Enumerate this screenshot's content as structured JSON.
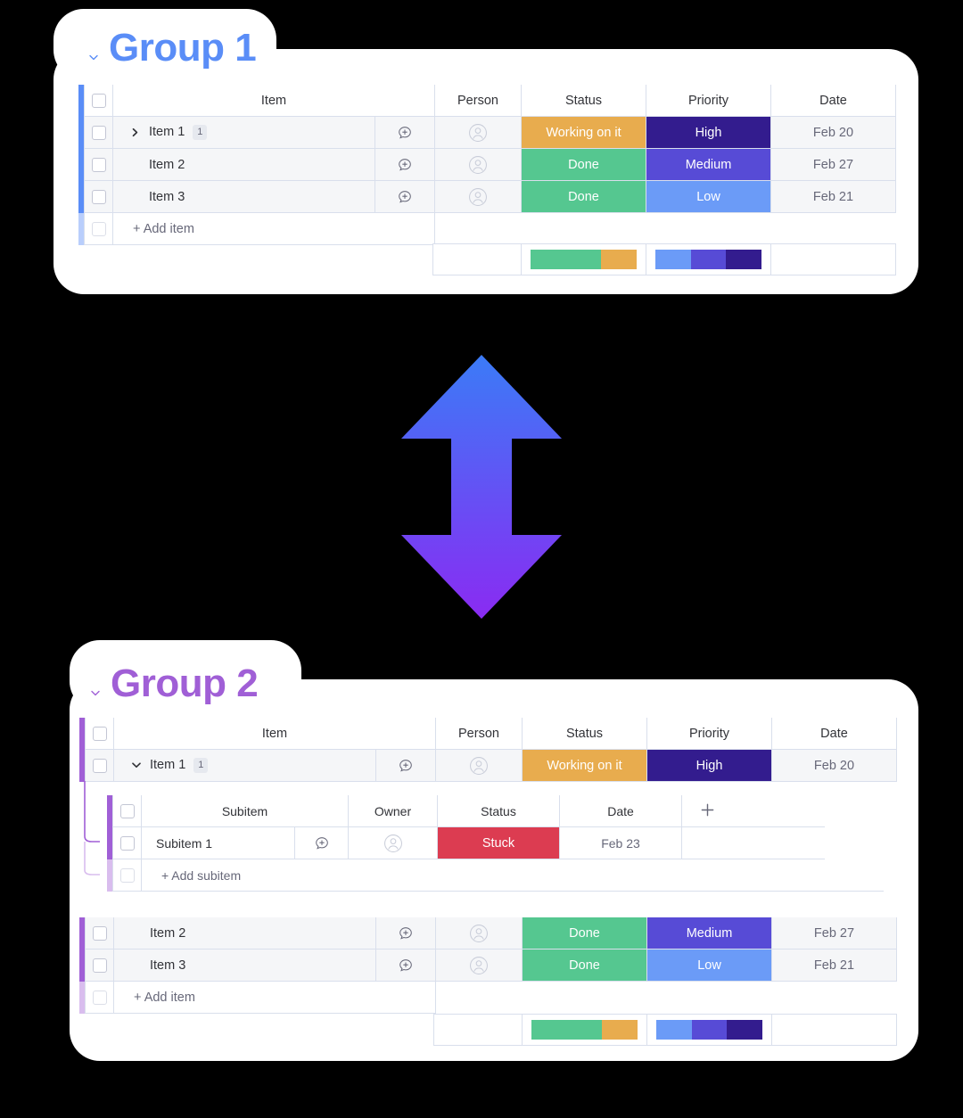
{
  "groups": [
    {
      "name": "Group 1",
      "accent": "#5A8DF7",
      "accent_light": "#b9cefc",
      "collapse_icon": "chevron-down-icon",
      "columns": [
        "Item",
        "Person",
        "Status",
        "Priority",
        "Date"
      ],
      "rows": [
        {
          "name": "Item 1",
          "count": "1",
          "expand_icon": "chevron-right-icon",
          "expanded": false,
          "chat_icon": "comment-add-icon",
          "person_icon": "avatar-icon",
          "status": "Working on it",
          "status_color": "#E8AC4E",
          "priority": "High",
          "priority_color": "#331C8E",
          "date": "Feb 20"
        },
        {
          "name": "Item 2",
          "count": "",
          "expand_icon": "",
          "expanded": false,
          "chat_icon": "comment-add-icon",
          "person_icon": "avatar-icon",
          "status": "Done",
          "status_color": "#55C790",
          "priority": "Medium",
          "priority_color": "#574BD6",
          "date": "Feb 27"
        },
        {
          "name": "Item 3",
          "count": "",
          "expand_icon": "",
          "expanded": false,
          "chat_icon": "comment-add-icon",
          "person_icon": "avatar-icon",
          "status": "Done",
          "status_color": "#55C790",
          "priority": "Low",
          "priority_color": "#6B9BF7",
          "date": "Feb 21"
        }
      ],
      "add_item_label": "+ Add item",
      "summary": {
        "status_segments": [
          {
            "label": "Done",
            "color": "#55C790",
            "pct": 66.7
          },
          {
            "label": "Working on it",
            "color": "#E8AC4E",
            "pct": 33.3
          }
        ],
        "priority_segments": [
          {
            "label": "Low",
            "color": "#6B9BF7",
            "pct": 33.3
          },
          {
            "label": "Medium",
            "color": "#574BD6",
            "pct": 33.3
          },
          {
            "label": "High",
            "color": "#331C8E",
            "pct": 33.4
          }
        ]
      }
    },
    {
      "name": "Group 2",
      "accent": "#A05FD6",
      "accent_light": "#d9bdee",
      "collapse_icon": "chevron-down-icon",
      "columns": [
        "Item",
        "Person",
        "Status",
        "Priority",
        "Date"
      ],
      "rows": [
        {
          "name": "Item 1",
          "count": "1",
          "expand_icon": "chevron-down-icon",
          "expanded": true,
          "chat_icon": "comment-add-icon",
          "person_icon": "avatar-icon",
          "status": "Working on it",
          "status_color": "#E8AC4E",
          "priority": "High",
          "priority_color": "#331C8E",
          "date": "Feb 20"
        },
        {
          "name": "Item 2",
          "count": "",
          "expand_icon": "",
          "expanded": false,
          "chat_icon": "comment-add-icon",
          "person_icon": "avatar-icon",
          "status": "Done",
          "status_color": "#55C790",
          "priority": "Medium",
          "priority_color": "#574BD6",
          "date": "Feb 27"
        },
        {
          "name": "Item 3",
          "count": "",
          "expand_icon": "",
          "expanded": false,
          "chat_icon": "comment-add-icon",
          "person_icon": "avatar-icon",
          "status": "Done",
          "status_color": "#55C790",
          "priority": "Low",
          "priority_color": "#6B9BF7",
          "date": "Feb 21"
        }
      ],
      "add_item_label": "+ Add item",
      "subitems": {
        "columns": [
          "Subitem",
          "Owner",
          "Status",
          "Date"
        ],
        "add_column_icon": "plus-icon",
        "rows": [
          {
            "name": "Subitem 1",
            "chat_icon": "comment-add-icon",
            "owner_icon": "avatar-icon",
            "status": "Stuck",
            "status_color": "#DC3C51",
            "date": "Feb 23"
          }
        ],
        "add_subitem_label": "+ Add subitem"
      },
      "summary": {
        "status_segments": [
          {
            "label": "Done",
            "color": "#55C790",
            "pct": 66.7
          },
          {
            "label": "Working on it",
            "color": "#E8AC4E",
            "pct": 33.3
          }
        ],
        "priority_segments": [
          {
            "label": "Low",
            "color": "#6B9BF7",
            "pct": 33.3
          },
          {
            "label": "Medium",
            "color": "#574BD6",
            "pct": 33.3
          },
          {
            "label": "High",
            "color": "#331C8E",
            "pct": 33.4
          }
        ]
      }
    }
  ],
  "arrow": {
    "icon": "double-arrow-vertical-icon",
    "gradient_top": "#3B7BF7",
    "gradient_bottom": "#8A2BF2"
  }
}
